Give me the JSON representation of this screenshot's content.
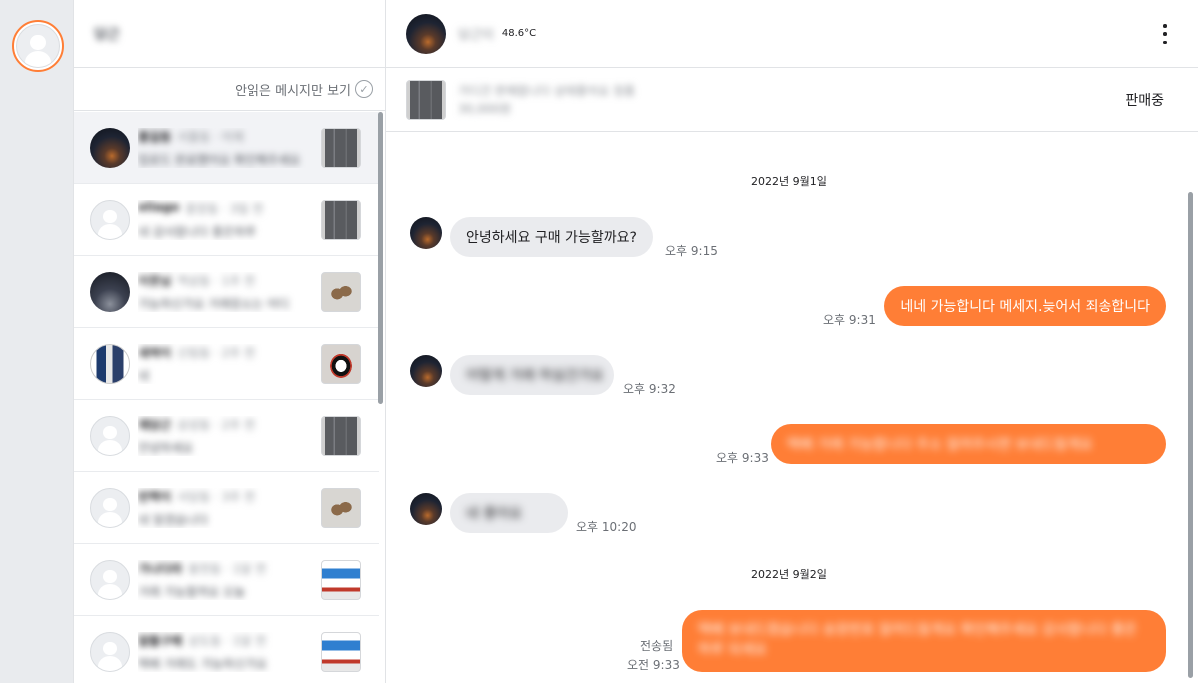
{
  "list": {
    "header_name": "당근",
    "filter_label": "안읽은 메시지만 보기",
    "rows": [
      {
        "name": "홍길동",
        "meta": "서울동 · 어제",
        "preview": "업로드 완료했어요 확인해주세요",
        "avatar": "night",
        "thumb": "cardigan"
      },
      {
        "name": "eliago",
        "meta": "중앙동 · 3일 전",
        "preview": "네 감사합니다 좋은하루",
        "avatar": "default",
        "thumb": "cardigan"
      },
      {
        "name": "이웃님",
        "meta": "역삼동 · 1주 전",
        "preview": "가능하신가요 거래장소는 어디",
        "avatar": "city",
        "thumb": "shoes"
      },
      {
        "name": "새싹이",
        "meta": "신림동 · 2주 전",
        "preview": "네",
        "avatar": "bw",
        "thumb": "sneaker"
      },
      {
        "name": "재당근",
        "meta": "삼성동 · 2주 전",
        "preview": "안녕하세요",
        "avatar": "default",
        "thumb": "cardigan"
      },
      {
        "name": "반짝이",
        "meta": "사당동 · 3주 전",
        "preview": "네 알겠습니다",
        "avatar": "default",
        "thumb": "shoes"
      },
      {
        "name": "가나다라",
        "meta": "봉천동 · 1달 전",
        "preview": "거래 가능할까요 오늘",
        "avatar": "default",
        "thumb": "box"
      },
      {
        "name": "알뜰구매",
        "meta": "상도동 · 1달 전",
        "preview": "택배 거래도 가능하신가요",
        "avatar": "default",
        "thumb": "box"
      }
    ]
  },
  "chat": {
    "partner_name": "당근이",
    "manner_temp": "48.6°C",
    "product_title": "가디건 판매합니다 상태좋아요 정품",
    "product_price": "30,000원",
    "product_status": "판매중",
    "date1": "2022년 9월1일",
    "date2": "2022년 9월2일",
    "messages": [
      {
        "dir": "in",
        "text": "안녕하세요 구매 가능할까요?",
        "time": "오후 9:15"
      },
      {
        "dir": "out",
        "text": "네네 가능합니다 메세지.늦어서 죄송합니다",
        "time": "오후 9:31"
      },
      {
        "dir": "in",
        "text": "어떻게 거래 하실건가요",
        "time": "오후 9:32"
      },
      {
        "dir": "out",
        "text": "택배 거래 가능합니다 주소 알려주시면 보내드릴게요",
        "time": "오후 9:33"
      },
      {
        "dir": "in",
        "text": "네 좋아요",
        "time": "오후 10:20"
      },
      {
        "dir": "out",
        "text": "택배 보내드렸습니다 송장번호 알려드릴게요 확인해주세요 감사합니다 좋은 하루 되세요",
        "time": "오전 9:33",
        "status": "전송됨"
      }
    ]
  },
  "colors": {
    "accent": "#ff7e36",
    "bubble_in": "#eaebee",
    "rail": "#e9ebee"
  }
}
